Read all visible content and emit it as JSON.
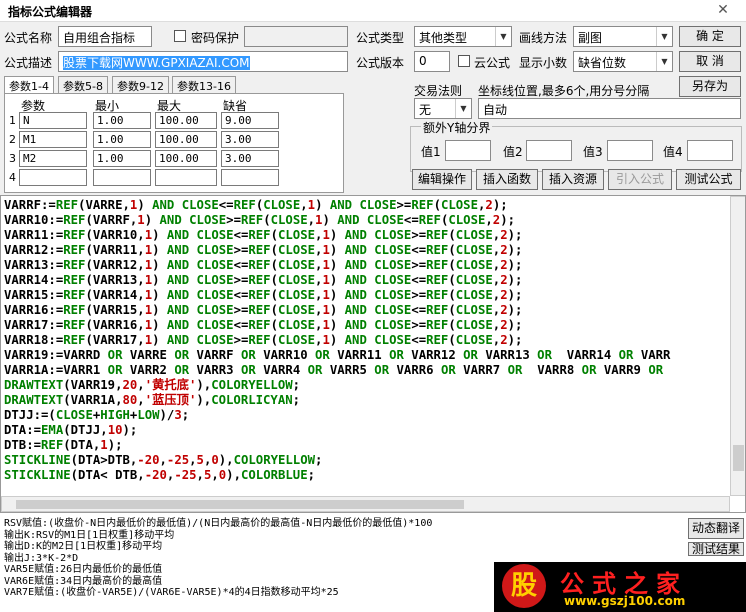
{
  "window": {
    "title": "指标公式编辑器",
    "close_icon": "✕"
  },
  "form": {
    "name_label": "公式名称",
    "name_value": "自用组合指标",
    "password_label": "密码保护",
    "desc_label": "公式描述",
    "desc_value": "股票下载网WWW.GPXIAZAI.COM",
    "type_label": "公式类型",
    "type_value": "其他类型",
    "draw_label": "画线方法",
    "draw_value": "副图",
    "version_label": "公式版本",
    "version_value": "0",
    "cloud_label": "云公式",
    "decimal_label": "显示小数",
    "decimal_value": "缺省位数",
    "trade_label": "交易法则",
    "trade_value": "无",
    "coord_label": "坐标线位置,最多6个,用分号分隔",
    "coord_value": "自动",
    "yaxis_label": "额外Y轴分界",
    "val_labels": [
      "值1",
      "值2",
      "值3",
      "值4"
    ]
  },
  "buttons": {
    "ok": "确  定",
    "cancel": "取  消",
    "saveas": "另存为",
    "edit": "编辑操作",
    "insert_fn": "插入函数",
    "insert_res": "插入资源",
    "import": "引入公式",
    "test": "测试公式",
    "dyn": "动态翻译",
    "test_result": "测试结果"
  },
  "tabs": [
    "参数1-4",
    "参数5-8",
    "参数9-12",
    "参数13-16"
  ],
  "params": {
    "headers": [
      "参数",
      "最小",
      "最大",
      "缺省"
    ],
    "rows": [
      {
        "n": "1",
        "name": "N",
        "min": "1.00",
        "max": "100.00",
        "def": "9.00"
      },
      {
        "n": "2",
        "name": "M1",
        "min": "1.00",
        "max": "100.00",
        "def": "3.00"
      },
      {
        "n": "3",
        "name": "M2",
        "min": "1.00",
        "max": "100.00",
        "def": "3.00"
      },
      {
        "n": "4",
        "name": "",
        "min": "",
        "max": "",
        "def": ""
      }
    ]
  },
  "code_lines": [
    "VARRF:=REF(VARRE,1) AND CLOSE<=REF(CLOSE,1) AND CLOSE>=REF(CLOSE,2);",
    "VARR10:=REF(VARRF,1) AND CLOSE>=REF(CLOSE,1) AND CLOSE<=REF(CLOSE,2);",
    "VARR11:=REF(VARR10,1) AND CLOSE<=REF(CLOSE,1) AND CLOSE>=REF(CLOSE,2);",
    "VARR12:=REF(VARR11,1) AND CLOSE>=REF(CLOSE,1) AND CLOSE<=REF(CLOSE,2);",
    "VARR13:=REF(VARR12,1) AND CLOSE<=REF(CLOSE,1) AND CLOSE>=REF(CLOSE,2);",
    "VARR14:=REF(VARR13,1) AND CLOSE>=REF(CLOSE,1) AND CLOSE<=REF(CLOSE,2);",
    "VARR15:=REF(VARR14,1) AND CLOSE<=REF(CLOSE,1) AND CLOSE>=REF(CLOSE,2);",
    "VARR16:=REF(VARR15,1) AND CLOSE>=REF(CLOSE,1) AND CLOSE<=REF(CLOSE,2);",
    "VARR17:=REF(VARR16,1) AND CLOSE<=REF(CLOSE,1) AND CLOSE>=REF(CLOSE,2);",
    "VARR18:=REF(VARR17,1) AND CLOSE>=REF(CLOSE,1) AND CLOSE<=REF(CLOSE,2);",
    "VARR19:=VARRD OR VARRE OR VARRF OR VARR10 OR VARR11 OR VARR12 OR VARR13 OR  VARR14 OR VARR",
    "VARR1A:=VARR1 OR VARR2 OR VARR3 OR VARR4 OR VARR5 OR VARR6 OR VARR7 OR  VARR8 OR VARR9 OR",
    "DRAWTEXT(VARR19,20,'黄托底'),COLORYELLOW;",
    "DRAWTEXT(VARR1A,80,'蓝压顶'),COLORLICYAN;",
    "DTJJ:=(CLOSE+HIGH+LOW)/3;",
    "DTA:=EMA(DTJJ,10);",
    "DTB:=REF(DTA,1);",
    "STICKLINE(DTA>DTB,-20,-25,5,0),COLORYELLOW;",
    "STICKLINE(DTA< DTB,-20,-25,5,0),COLORBLUE;"
  ],
  "output": "RSV赋值:(收盘价-N日内最低价的最低值)/(N日内最高价的最高值-N日内最低价的最低值)*100\n输出K:RSV的M1日[1日权重]移动平均\n输出D:K的M2日[1日权重]移动平均\n输出J:3*K-2*D\nVAR5E赋值:26日内最低价的最低值\nVAR6E赋值:34日内最高价的最高值\nVAR7E赋值:(收盘价-VAR5E)/(VAR6E-VAR5E)*4的4日指数移动平均*25",
  "watermark": {
    "logo_char": "股",
    "text": "公式之家",
    "url": "www.gszj100.com"
  },
  "colors": {
    "keyword": "#008000",
    "number": "#c00000",
    "function": "#008080",
    "watermark_text": "#ff2020",
    "watermark_bg": "#000000"
  }
}
